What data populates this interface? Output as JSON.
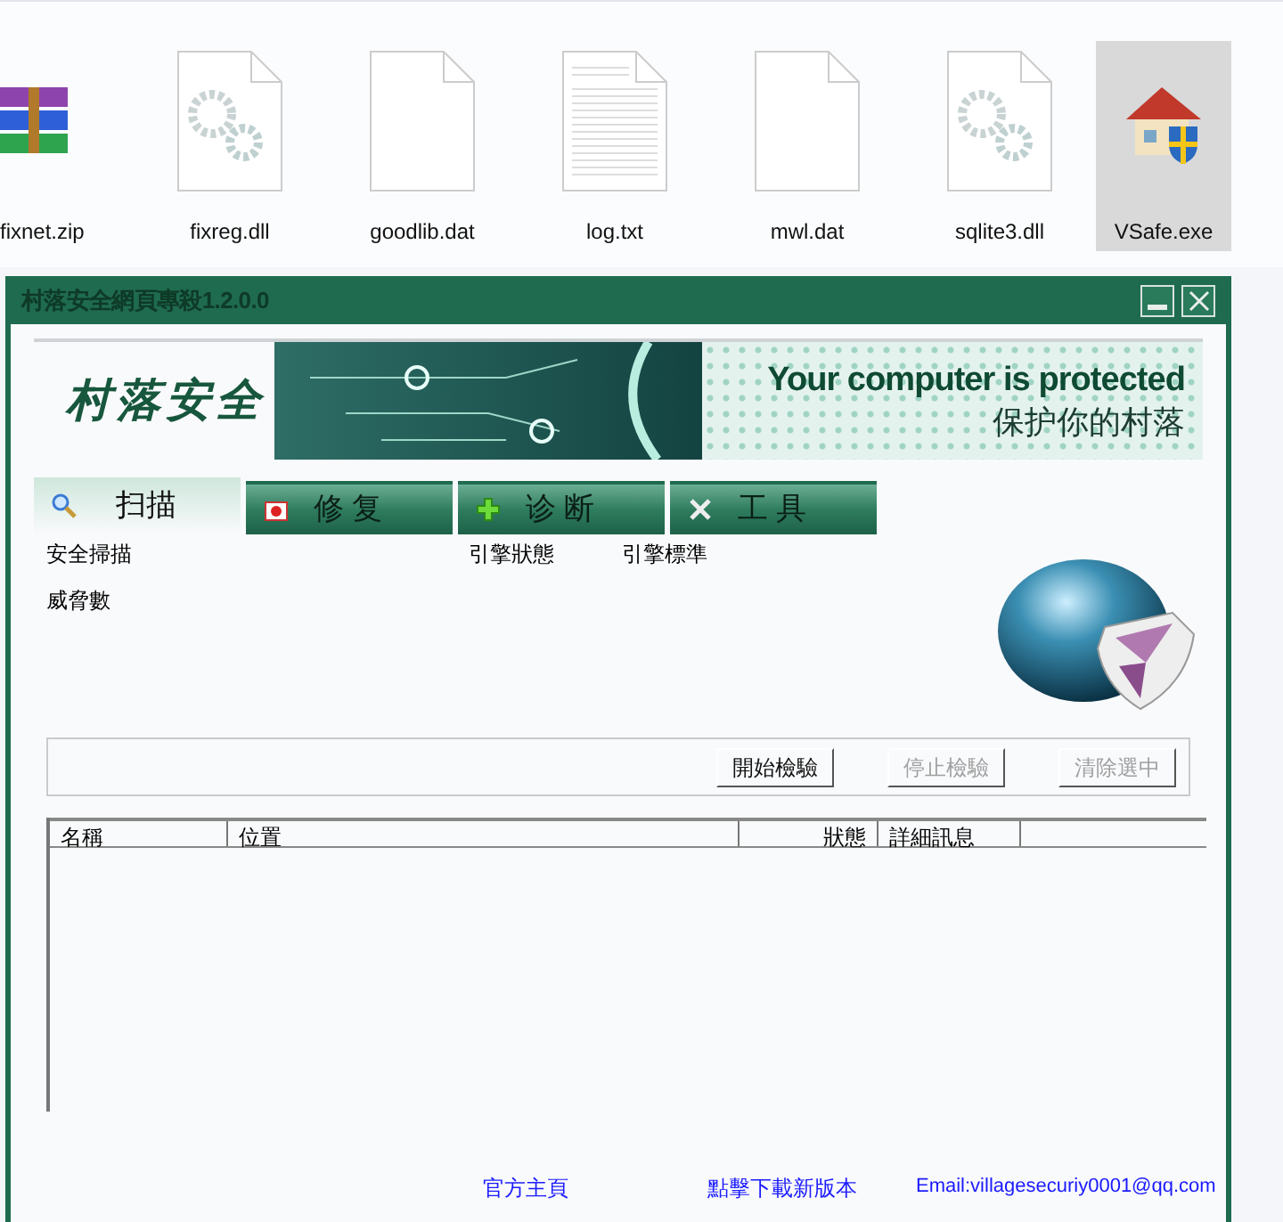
{
  "files": [
    {
      "name": "fixnet.zip",
      "kind": "archive",
      "selected": false
    },
    {
      "name": "fixreg.dll",
      "kind": "gears",
      "selected": false
    },
    {
      "name": "goodlib.dat",
      "kind": "blank",
      "selected": false
    },
    {
      "name": "log.txt",
      "kind": "text",
      "selected": false
    },
    {
      "name": "mwl.dat",
      "kind": "blank",
      "selected": false
    },
    {
      "name": "sqlite3.dll",
      "kind": "gears",
      "selected": false
    },
    {
      "name": "VSafe.exe",
      "kind": "app",
      "selected": true
    }
  ],
  "window": {
    "title": "村落安全網頁專殺1.2.0.0"
  },
  "banner": {
    "logo": "村落安全",
    "headline": "Your computer is protected",
    "subtitle": "保护你的村落"
  },
  "tabs": [
    {
      "label": "扫描",
      "kind": "search",
      "selected": true
    },
    {
      "label": "修 复",
      "kind": "kit",
      "selected": false
    },
    {
      "label": "诊 断",
      "kind": "plus",
      "selected": false
    },
    {
      "label": "工 具",
      "kind": "tools",
      "selected": false
    }
  ],
  "info": {
    "scan_label": "安全掃描",
    "engine_status": "引擎狀態",
    "engine_standard": "引擎標準",
    "threats_label": "威脅數"
  },
  "buttons": [
    {
      "label": "開始檢驗",
      "disabled": false
    },
    {
      "label": "停止檢驗",
      "disabled": true
    },
    {
      "label": "清除選中",
      "disabled": true
    }
  ],
  "table": {
    "columns": [
      "名稱",
      "位置",
      "狀態",
      "詳細訊息"
    ]
  },
  "footer": {
    "links": [
      "官方主頁",
      "點擊下載新版本",
      "Email:villagesecuriy0001@qq.com"
    ]
  }
}
